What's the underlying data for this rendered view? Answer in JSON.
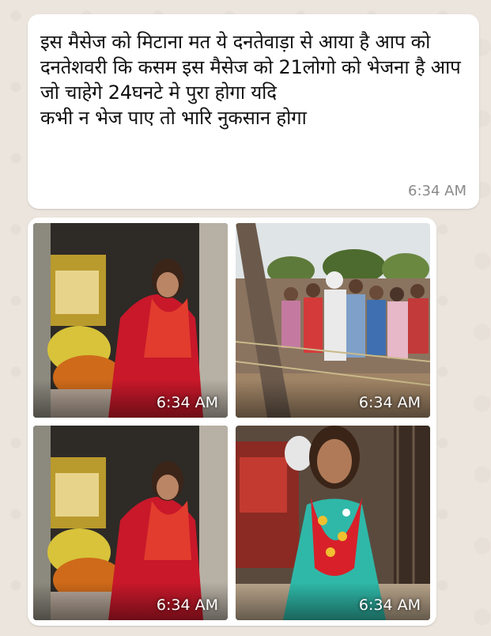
{
  "message": {
    "text": "इस मैसेज को मिटाना मत ये दनतेवाड़ा से आया है आप को दनतेशवरी कि कसम इस मैसेज को 21लोगो को भेजना है आप जो चाहेगे 24घनटे मे पुरा होगा यदि\nकभी न भेज पाए तो भारि नुकसान होगा",
    "time": "6:34 AM"
  },
  "media": {
    "photos": [
      {
        "subject": "bride-at-shrine",
        "time": "6:34 AM"
      },
      {
        "subject": "crowd-of-villagers",
        "time": "6:34 AM"
      },
      {
        "subject": "bride-at-shrine",
        "time": "6:34 AM"
      },
      {
        "subject": "girl-with-flower-garland",
        "time": "6:34 AM"
      }
    ]
  },
  "colors": {
    "chat_background": "#ece5dd",
    "bubble": "#ffffff",
    "timestamp": "#8a8a8a"
  }
}
